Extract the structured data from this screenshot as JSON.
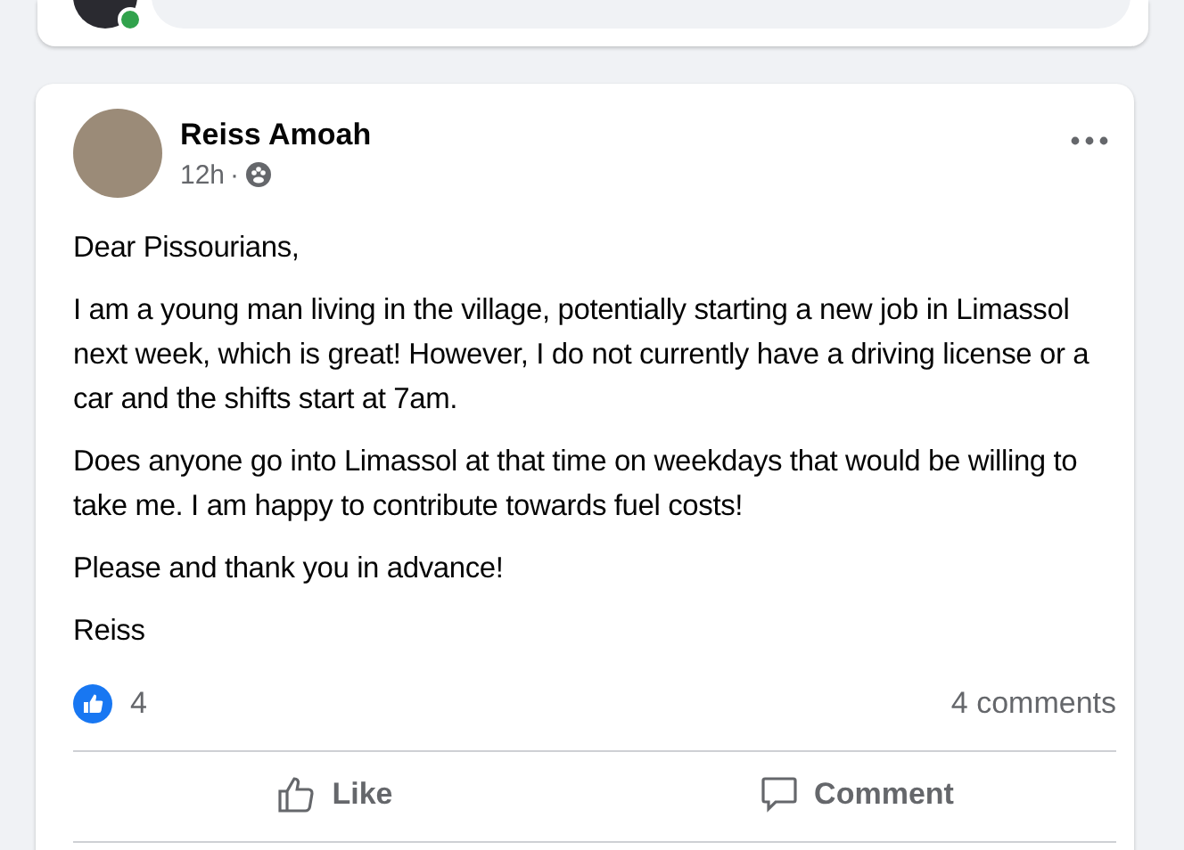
{
  "previous_post": {
    "commenter_online": true
  },
  "post": {
    "author": "Reiss Amoah",
    "time": "12h",
    "separator": "·",
    "paragraphs": [
      "Dear Pissourians,",
      "I am a young man living in the village, potentially starting a new job in Limassol next week, which is great! However, I do not currently have a driving license or a car and the shifts start at 7am.",
      "Does anyone go into Limassol at that time on weekdays that would be willing to take me. I am happy to contribute towards fuel costs!",
      "Please and thank you in advance!",
      "Reiss"
    ],
    "reaction_count": "4",
    "comment_count": "4 comments",
    "actions": [
      {
        "kind": "like",
        "label": "Like"
      },
      {
        "kind": "comment",
        "label": "Comment"
      }
    ]
  }
}
